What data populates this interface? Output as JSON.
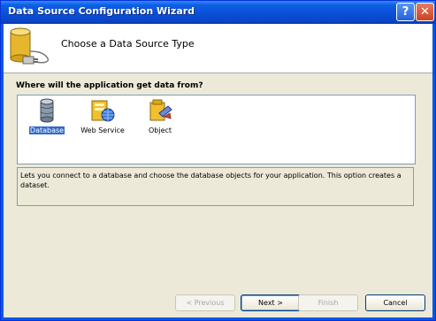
{
  "window": {
    "title": "Data Source Configuration Wizard",
    "help_label": "?",
    "close_label": "✕"
  },
  "header": {
    "title": "Choose a Data Source Type"
  },
  "prompt": "Where will the application get data from?",
  "data_source_types": [
    {
      "label": "Database",
      "icon": "database-icon",
      "selected": true
    },
    {
      "label": "Web Service",
      "icon": "web-service-icon",
      "selected": false
    },
    {
      "label": "Object",
      "icon": "object-icon",
      "selected": false
    }
  ],
  "description": "Lets you connect to a database and choose the database objects for your application. This option creates a dataset.",
  "buttons": {
    "previous": "< Previous",
    "next": "Next >",
    "finish": "Finish",
    "cancel": "Cancel"
  },
  "colors": {
    "titlebar": "#0a56e4",
    "selection": "#316ac5",
    "dialog_face": "#ece9d8"
  }
}
